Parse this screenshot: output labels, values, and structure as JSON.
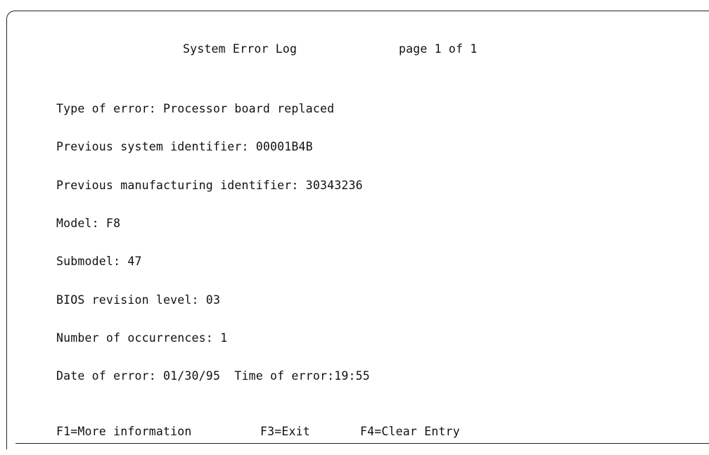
{
  "screen": {
    "title": "System Error Log",
    "page_indicator": "page 1 of 1"
  },
  "fields": [
    "Type of error: Processor board replaced",
    "Previous system identifier: 00001B4B",
    "Previous manufacturing identifier: 30343236",
    "Model: F8",
    "Submodel: 47",
    "BIOS revision level: 03",
    "Number of occurrences: 1",
    "Date of error: 01/30/95  Time of error:19:55"
  ],
  "function_keys": {
    "f1": "F1=More information",
    "f3": "F3=Exit",
    "f4": "F4=Clear Entry"
  }
}
